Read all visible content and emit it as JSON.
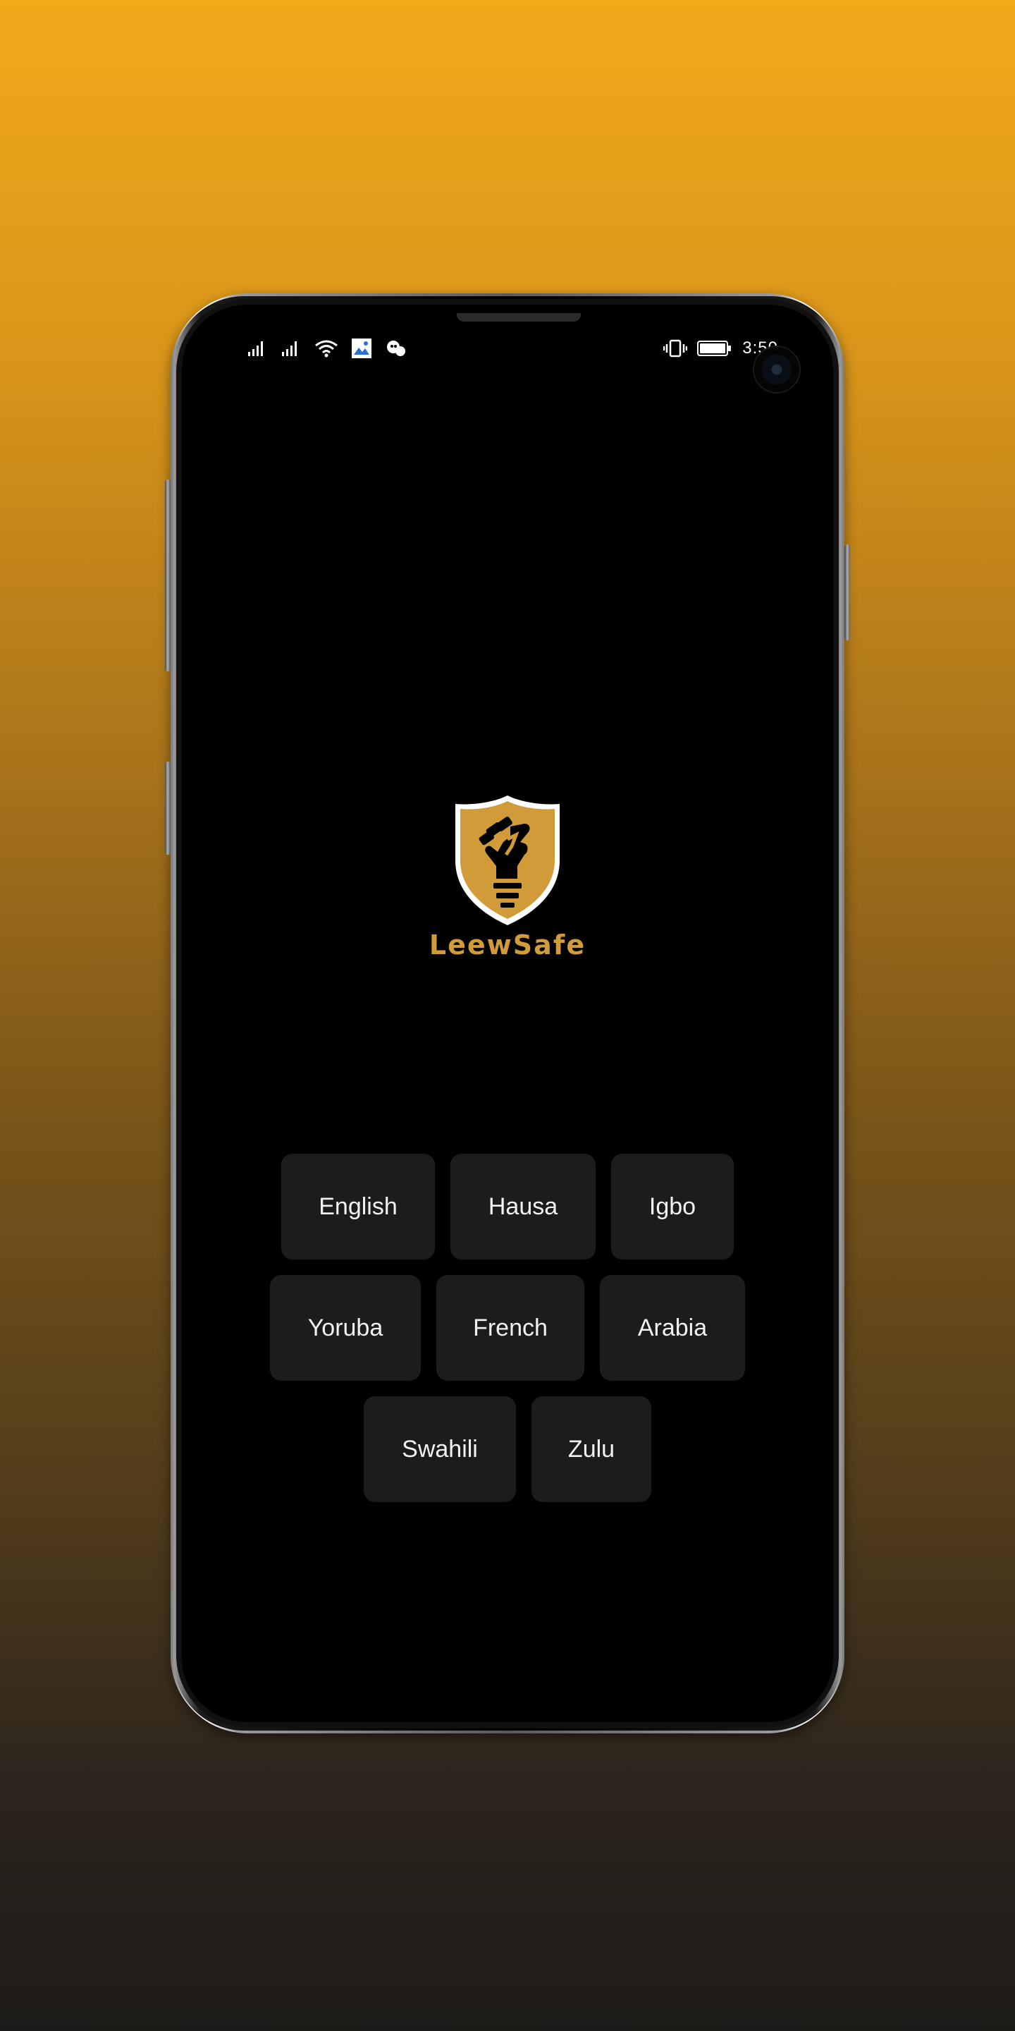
{
  "status_bar": {
    "time": "3:50",
    "left_icons": [
      "signal-1-icon",
      "signal-2-icon",
      "wifi-icon",
      "photo-notification-icon",
      "app-notification-icon"
    ],
    "right_icons": [
      "vibrate-icon",
      "battery-icon"
    ]
  },
  "app": {
    "brand_name": "LeewSafe",
    "brand_color": "#D19B3A",
    "logo_icon": "shield-fist-icon"
  },
  "languages": {
    "row1": [
      "English",
      "Hausa",
      "Igbo"
    ],
    "row2": [
      "Yoruba",
      "French",
      "Arabia"
    ],
    "row3": [
      "Swahili",
      "Zulu"
    ]
  },
  "colors": {
    "background_top": "#F2A91A",
    "background_bottom": "#1D1B19",
    "screen": "#000000",
    "button_bg": "#1C1C1C",
    "button_text": "#F2F2F2"
  }
}
